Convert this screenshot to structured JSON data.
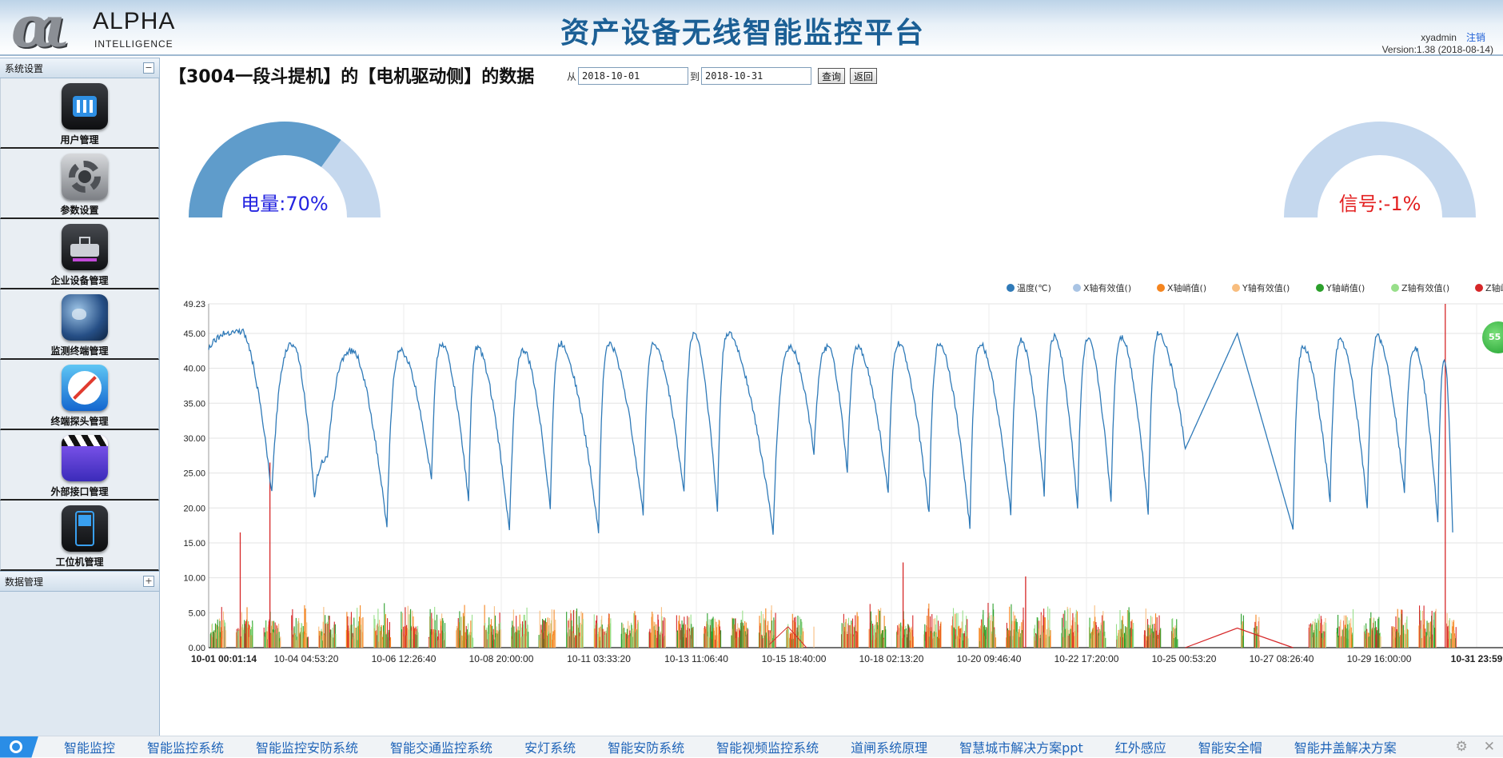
{
  "header": {
    "logo_name": "ALPHA",
    "logo_sub": "INTELLIGENCE",
    "title": "资产设备无线智能监控平台",
    "username": "xyadmin",
    "logout_label": "注销",
    "version": "Version:1.38 (2018-08-14)"
  },
  "sidebar": {
    "section1": "系统设置",
    "section1_toggle": "−",
    "items": [
      {
        "label": "用户管理",
        "icon": "users-icon"
      },
      {
        "label": "参数设置",
        "icon": "gear-icon"
      },
      {
        "label": "企业设备管理",
        "icon": "device-icon"
      },
      {
        "label": "监测终端管理",
        "icon": "globe-icon"
      },
      {
        "label": "终端探头管理",
        "icon": "compass-icon"
      },
      {
        "label": "外部接口管理",
        "icon": "clapper-icon"
      },
      {
        "label": "工位机管理",
        "icon": "handheld-icon"
      }
    ],
    "section2": "数据管理",
    "section2_toggle": "+"
  },
  "main": {
    "title": "【3004一段斗提机】的【电机驱动侧】的数据",
    "from_label": "从",
    "from_value": "2018-10-01",
    "to_label": "到",
    "to_value": "2018-10-31",
    "query_button": "查询",
    "back_button": "返回"
  },
  "gauges": {
    "power": {
      "text": "电量:70%",
      "value": 0.7,
      "color": "#5f9ccb",
      "track": "#c5d8ee",
      "text_color": "#2323e0"
    },
    "signal": {
      "text": "信号:-1%",
      "value": 0.0,
      "color": "#5f9ccb",
      "track": "#c5d8ee",
      "text_color": "#e32020"
    }
  },
  "chart_data": {
    "type": "line",
    "ylim": [
      0,
      49.23
    ],
    "yticks": [
      "0.00",
      "5.00",
      "10.00",
      "15.00",
      "20.00",
      "25.00",
      "30.00",
      "35.00",
      "40.00",
      "45.00",
      "49.23"
    ],
    "xticks": [
      "10-01 00:01:14",
      "10-04 04:53:20",
      "10-06 12:26:40",
      "10-08 20:00:00",
      "10-11 03:33:20",
      "10-13 11:06:40",
      "10-15 18:40:00",
      "10-18 02:13:20",
      "10-20 09:46:40",
      "10-22 17:20:00",
      "10-25 00:53:20",
      "10-27 08:26:40",
      "10-29 16:00:00",
      "10-31 23:59"
    ],
    "grid": true,
    "legend_position": "top-right",
    "series": [
      {
        "name": "温度(℃)",
        "color": "#2f7ab8"
      },
      {
        "name": "X轴有效值()",
        "color": "#a9c4e4"
      },
      {
        "name": "X轴峭值()",
        "color": "#f5851f"
      },
      {
        "name": "Y轴有效值()",
        "color": "#f8bd7e"
      },
      {
        "name": "Y轴峭值()",
        "color": "#2ca02c"
      },
      {
        "name": "Z轴有效值()",
        "color": "#98df8a"
      },
      {
        "name": "Z轴峭值()",
        "color": "#d62728"
      }
    ],
    "temperature_cycles": [
      [
        0.0,
        43
      ],
      [
        0.9,
        45.3
      ],
      [
        1.7,
        22
      ],
      [
        2.3,
        43.5
      ],
      [
        2.85,
        21.5
      ],
      [
        3.2,
        27
      ],
      [
        3.9,
        42.5
      ],
      [
        4.8,
        17
      ],
      [
        5.2,
        42.5
      ],
      [
        6.0,
        24
      ],
      [
        6.3,
        43.5
      ],
      [
        7.0,
        21
      ],
      [
        7.25,
        43
      ],
      [
        8.1,
        16.5
      ],
      [
        8.5,
        42.5
      ],
      [
        9.2,
        20
      ],
      [
        9.5,
        43.5
      ],
      [
        10.5,
        16.5
      ],
      [
        10.8,
        43.5
      ],
      [
        11.7,
        19
      ],
      [
        12.0,
        43.5
      ],
      [
        12.8,
        22
      ],
      [
        13.1,
        45
      ],
      [
        13.7,
        19.5
      ],
      [
        14.0,
        45
      ],
      [
        15.2,
        16.5
      ],
      [
        15.7,
        43
      ],
      [
        16.3,
        28
      ],
      [
        16.7,
        43
      ],
      [
        17.2,
        25
      ],
      [
        17.5,
        43
      ],
      [
        18.3,
        22
      ],
      [
        18.6,
        43.5
      ],
      [
        19.4,
        19
      ],
      [
        19.7,
        43.5
      ],
      [
        20.5,
        17
      ],
      [
        20.8,
        43.5
      ],
      [
        21.6,
        19
      ],
      [
        21.9,
        44
      ],
      [
        22.5,
        22
      ],
      [
        22.8,
        44.5
      ],
      [
        23.4,
        20
      ],
      [
        23.7,
        44
      ],
      [
        24.3,
        21
      ],
      [
        24.6,
        44.5
      ],
      [
        25.3,
        19.5
      ],
      [
        25.6,
        45
      ],
      [
        26.3,
        28.5
      ],
      [
        27.7,
        45
      ],
      [
        29.2,
        17
      ],
      [
        29.5,
        43
      ],
      [
        30.2,
        21
      ],
      [
        30.5,
        44
      ],
      [
        31.2,
        20
      ],
      [
        31.5,
        44.5
      ],
      [
        32.2,
        22
      ],
      [
        32.5,
        43
      ],
      [
        33.1,
        18
      ],
      [
        33.3,
        41
      ],
      [
        33.5,
        16.5
      ]
    ],
    "vibration_peaks": [
      {
        "x": 0.85,
        "y": 16.5
      },
      {
        "x": 1.65,
        "y": 26.5
      },
      {
        "x": 18.7,
        "y": 12.2
      },
      {
        "x": 22.0,
        "y": 10.2
      },
      {
        "x": 33.3,
        "y": 49.23
      }
    ]
  },
  "float_badge": "55",
  "bottom_links": [
    "智能监控",
    "智能监控系统",
    "智能监控安防系统",
    "智能交通监控系统",
    "安灯系统",
    "智能安防系统",
    "智能视频监控系统",
    "道闸系统原理",
    "智慧城市解决方案ppt",
    "红外感应",
    "智能安全帽",
    "智能井盖解决方案"
  ]
}
